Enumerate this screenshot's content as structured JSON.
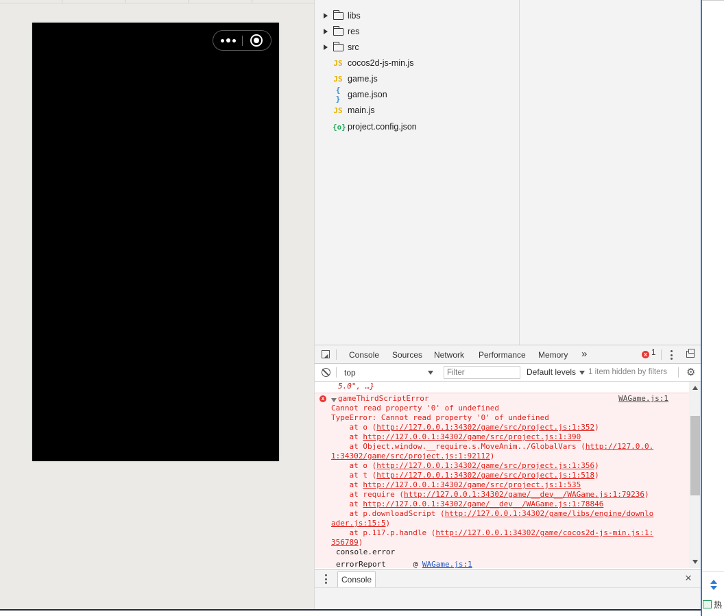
{
  "file_tree": {
    "items": [
      {
        "type": "folder",
        "name": "libs"
      },
      {
        "type": "folder",
        "name": "res"
      },
      {
        "type": "folder",
        "name": "src"
      },
      {
        "type": "js",
        "name": "cocos2d-js-min.js",
        "icon": "JS"
      },
      {
        "type": "js",
        "name": "game.js",
        "icon": "JS"
      },
      {
        "type": "json",
        "name": "game.json",
        "icon": "{ }"
      },
      {
        "type": "js",
        "name": "main.js",
        "icon": "JS"
      },
      {
        "type": "config",
        "name": "project.config.json",
        "icon": "{o}"
      }
    ]
  },
  "devtools": {
    "tabs": [
      "Console",
      "Sources",
      "Network",
      "Performance",
      "Memory"
    ],
    "more_tabs": "»",
    "active_tab": "Console",
    "error_count": "1",
    "error_badge": "x",
    "context": "top",
    "filter_placeholder": "Filter",
    "levels": "Default levels",
    "hidden_note": "1 item hidden by filters",
    "settings_glyph": "⚙",
    "console": {
      "prev_line": "5.0\", …}",
      "error_title": "gameThirdScriptError",
      "error_source": "WAGame.js:1",
      "lines": [
        "Cannot read property '0' of undefined",
        "TypeError: Cannot read property '0' of undefined"
      ],
      "stack": [
        {
          "pre": "    at o (",
          "link": "http://127.0.0.1:34302/game/src/project.js:1:352",
          "post": ")"
        },
        {
          "pre": "    at ",
          "link": "http://127.0.0.1:34302/game/src/project.js:1:390",
          "post": ""
        },
        {
          "pre": "    at Object.window.__require.s.MoveAnim../GlobalVars (",
          "link": "http://127.0.0.",
          "post": ""
        },
        {
          "pre": "",
          "link": "1:34302/game/src/project.js:1:92112",
          "post": ")"
        },
        {
          "pre": "    at o (",
          "link": "http://127.0.0.1:34302/game/src/project.js:1:356",
          "post": ")"
        },
        {
          "pre": "    at t (",
          "link": "http://127.0.0.1:34302/game/src/project.js:1:518",
          "post": ")"
        },
        {
          "pre": "    at ",
          "link": "http://127.0.0.1:34302/game/src/project.js:1:535",
          "post": ""
        },
        {
          "pre": "    at require (",
          "link": "http://127.0.0.1:34302/game/__dev__/WAGame.js:1:79236",
          "post": ")"
        },
        {
          "pre": "    at ",
          "link": "http://127.0.0.1:34302/game/__dev__/WAGame.js:1:78846",
          "post": ""
        },
        {
          "pre": "    at p.downloadScript (",
          "link": "http://127.0.0.1:34302/game/libs/engine/downlo",
          "post": ""
        },
        {
          "pre": "",
          "link": "ader.js:15:5",
          "post": ")"
        },
        {
          "pre": "    at p.117.p.handle (",
          "link": "http://127.0.0.1:34302/game/cocos2d-js-min.js:1:",
          "post": ""
        },
        {
          "pre": "",
          "link": "356789",
          "post": ")"
        }
      ],
      "trace_line1": "console.error",
      "trace_line2_fn": "errorReport",
      "trace_line2_at": "@ ",
      "trace_line2_link": "WAGame.js:1"
    },
    "drawer_tab": "Console",
    "drawer_close": "×"
  },
  "right_strip": {
    "hot_text": "热"
  }
}
